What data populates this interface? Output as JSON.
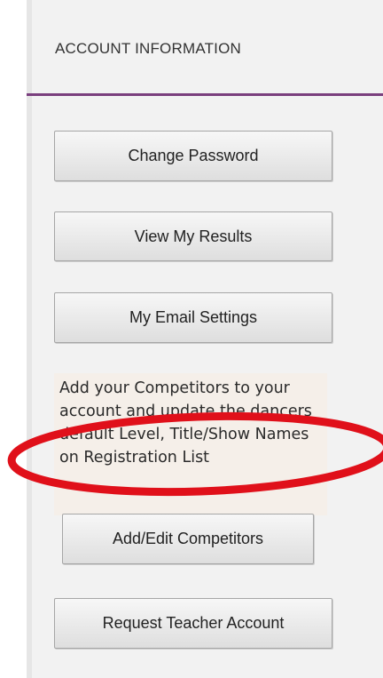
{
  "sidebar": {
    "title": "ACCOUNT INFORMATION",
    "buttons": {
      "change_password": "Change Password",
      "view_results": "View My Results",
      "email_settings": "My Email Settings",
      "add_edit_competitors": "Add/Edit Competitors",
      "request_teacher": "Request Teacher Account"
    },
    "competitors_info": "Add your Competitors to your account and update the dancers default Level, Title/Show Names on Registration List"
  },
  "colors": {
    "divider": "#7a3f7e",
    "annotation": "#e0101a"
  }
}
